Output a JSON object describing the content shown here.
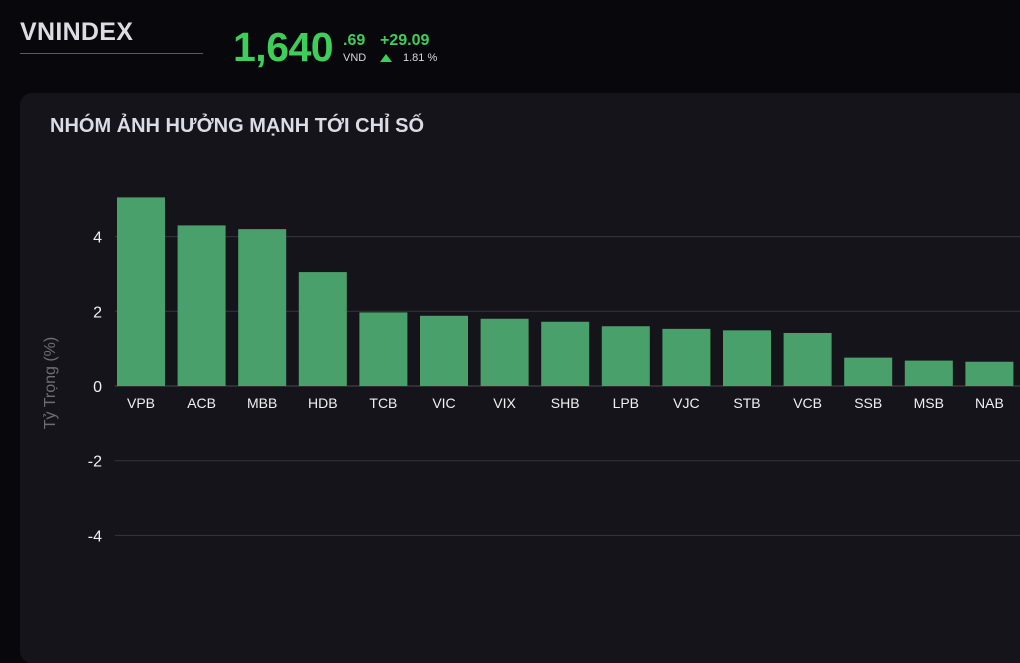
{
  "header": {
    "index_name": "VNINDEX",
    "price_main": "1,640",
    "price_decimal": ".69",
    "price_unit": "VND",
    "change_value": "+29.09",
    "change_percent": "1.81 %",
    "change_direction": "up-arrow-icon"
  },
  "panel": {
    "title": "NHÓM ẢNH HƯỞNG MẠNH TỚI CHỈ SỐ"
  },
  "colors": {
    "positive": "#3fce5a",
    "bar": "#4aa06a",
    "background": "#07070c",
    "panel": "#16141b"
  },
  "chart_data": {
    "type": "bar",
    "categories": [
      "VPB",
      "ACB",
      "MBB",
      "HDB",
      "TCB",
      "VIC",
      "VIX",
      "SHB",
      "LPB",
      "VJC",
      "STB",
      "VCB",
      "SSB",
      "MSB",
      "NAB"
    ],
    "values": [
      5.05,
      4.3,
      4.2,
      3.05,
      1.97,
      1.88,
      1.8,
      1.72,
      1.6,
      1.53,
      1.49,
      1.42,
      0.76,
      0.68,
      0.65
    ],
    "title": "",
    "xlabel": "",
    "ylabel": "Tỷ Trọng (%)",
    "ylim": [
      -5,
      5.6
    ],
    "yticks": [
      4,
      2,
      0,
      -2,
      -4
    ],
    "grid": true,
    "legend": "none"
  }
}
